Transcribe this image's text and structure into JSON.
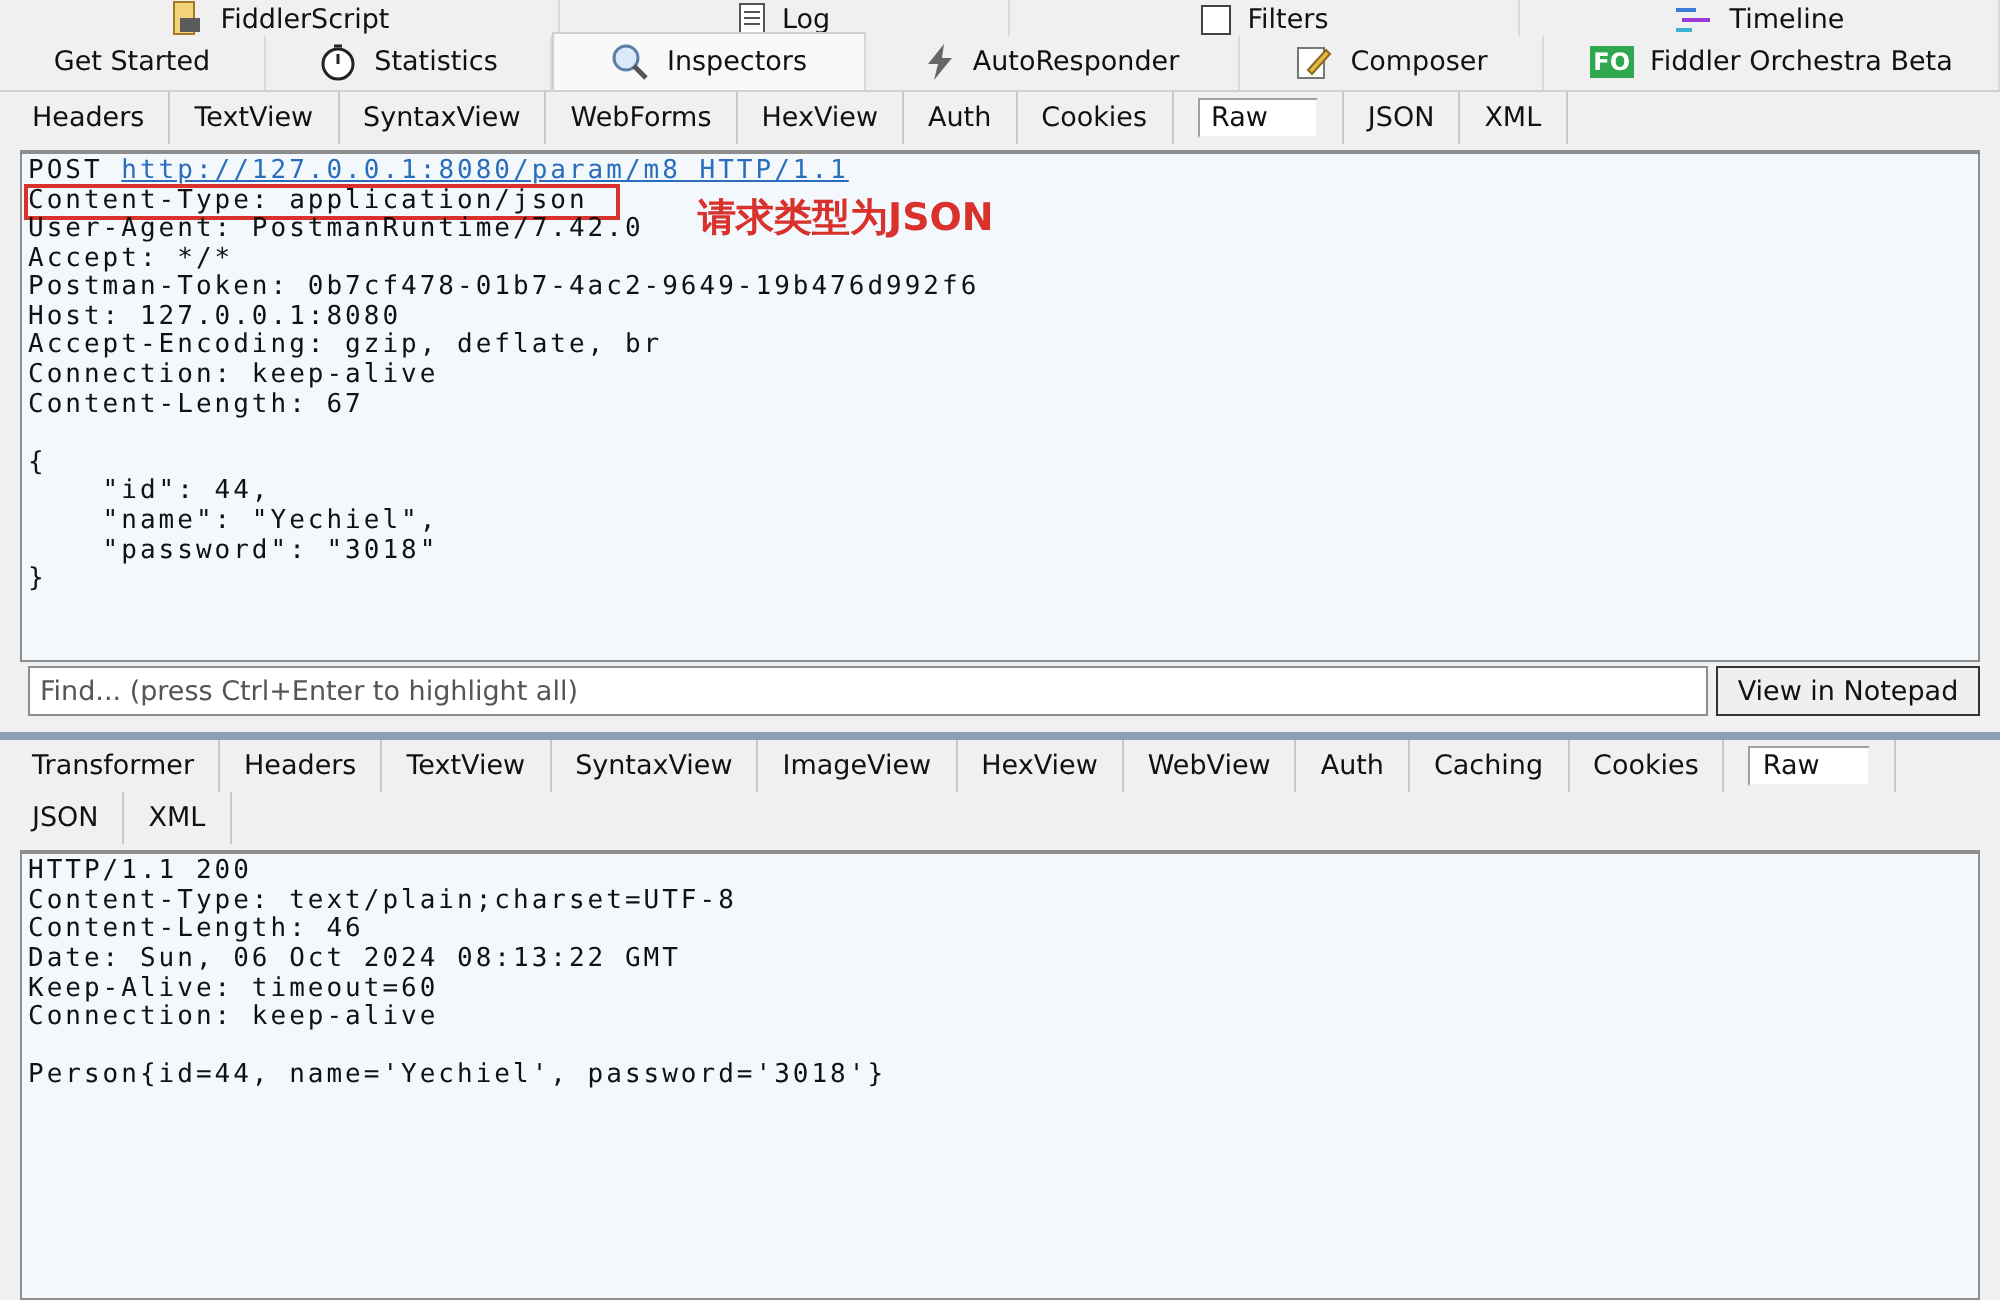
{
  "top_tabs": [
    {
      "label": "FiddlerScript"
    },
    {
      "label": "Log"
    },
    {
      "label": "Filters"
    },
    {
      "label": "Timeline"
    }
  ],
  "main_tabs": [
    {
      "label": "Get Started",
      "selected": false
    },
    {
      "label": "Statistics",
      "selected": false
    },
    {
      "label": "Inspectors",
      "selected": true
    },
    {
      "label": "AutoResponder",
      "selected": false
    },
    {
      "label": "Composer",
      "selected": false
    },
    {
      "label": "Fiddler Orchestra Beta",
      "badge": "FO",
      "selected": false
    }
  ],
  "request": {
    "tabs": [
      {
        "label": "Headers",
        "selected": false
      },
      {
        "label": "TextView",
        "selected": false
      },
      {
        "label": "SyntaxView",
        "selected": false
      },
      {
        "label": "WebForms",
        "selected": false
      },
      {
        "label": "HexView",
        "selected": false
      },
      {
        "label": "Auth",
        "selected": false
      },
      {
        "label": "Cookies",
        "selected": false
      },
      {
        "label": "Raw",
        "selected": true
      },
      {
        "label": "JSON",
        "selected": false
      },
      {
        "label": "XML",
        "selected": false
      }
    ],
    "method": "POST",
    "url": "http://127.0.0.1:8080/param/m8 HTTP/1.1",
    "headers": [
      {
        "text": "Content-Type: application/json",
        "highlighted": true
      },
      {
        "text": "User-Agent: PostmanRuntime/7.42.0",
        "highlighted": false
      },
      {
        "text": "Accept: */*",
        "highlighted": false
      },
      {
        "text": "Postman-Token: 0b7cf478-01b7-4ac2-9649-19b476d992f6",
        "highlighted": false
      },
      {
        "text": "Host: 127.0.0.1:8080",
        "highlighted": false
      },
      {
        "text": "Accept-Encoding: gzip, deflate, br",
        "highlighted": false
      },
      {
        "text": "Connection: keep-alive",
        "highlighted": false
      },
      {
        "text": "Content-Length: 67",
        "highlighted": false
      }
    ],
    "body": [
      "{",
      "    \"id\": 44,",
      "    \"name\": \"Yechiel\",",
      "    \"password\": \"3018\"",
      "}"
    ],
    "annotation": "请求类型为JSON",
    "find": {
      "placeholder": "Find... (press Ctrl+Enter to highlight all)"
    },
    "notepad_button": "View in Notepad"
  },
  "response": {
    "tabs": [
      {
        "label": "Transformer",
        "selected": false
      },
      {
        "label": "Headers",
        "selected": false
      },
      {
        "label": "TextView",
        "selected": false
      },
      {
        "label": "SyntaxView",
        "selected": false
      },
      {
        "label": "ImageView",
        "selected": false
      },
      {
        "label": "HexView",
        "selected": false
      },
      {
        "label": "WebView",
        "selected": false
      },
      {
        "label": "Auth",
        "selected": false
      },
      {
        "label": "Caching",
        "selected": false
      },
      {
        "label": "Cookies",
        "selected": false
      },
      {
        "label": "Raw",
        "selected": true
      },
      {
        "label": "JSON",
        "selected": false
      },
      {
        "label": "XML",
        "selected": false
      }
    ],
    "headers": [
      "HTTP/1.1 200",
      "Content-Type: text/plain;charset=UTF-8",
      "Content-Length: 46",
      "Date: Sun, 06 Oct 2024 08:13:22 GMT",
      "Keep-Alive: timeout=60",
      "Connection: keep-alive"
    ],
    "body": [
      "Person{id=44, name='Yechiel', password='3018'}"
    ]
  }
}
